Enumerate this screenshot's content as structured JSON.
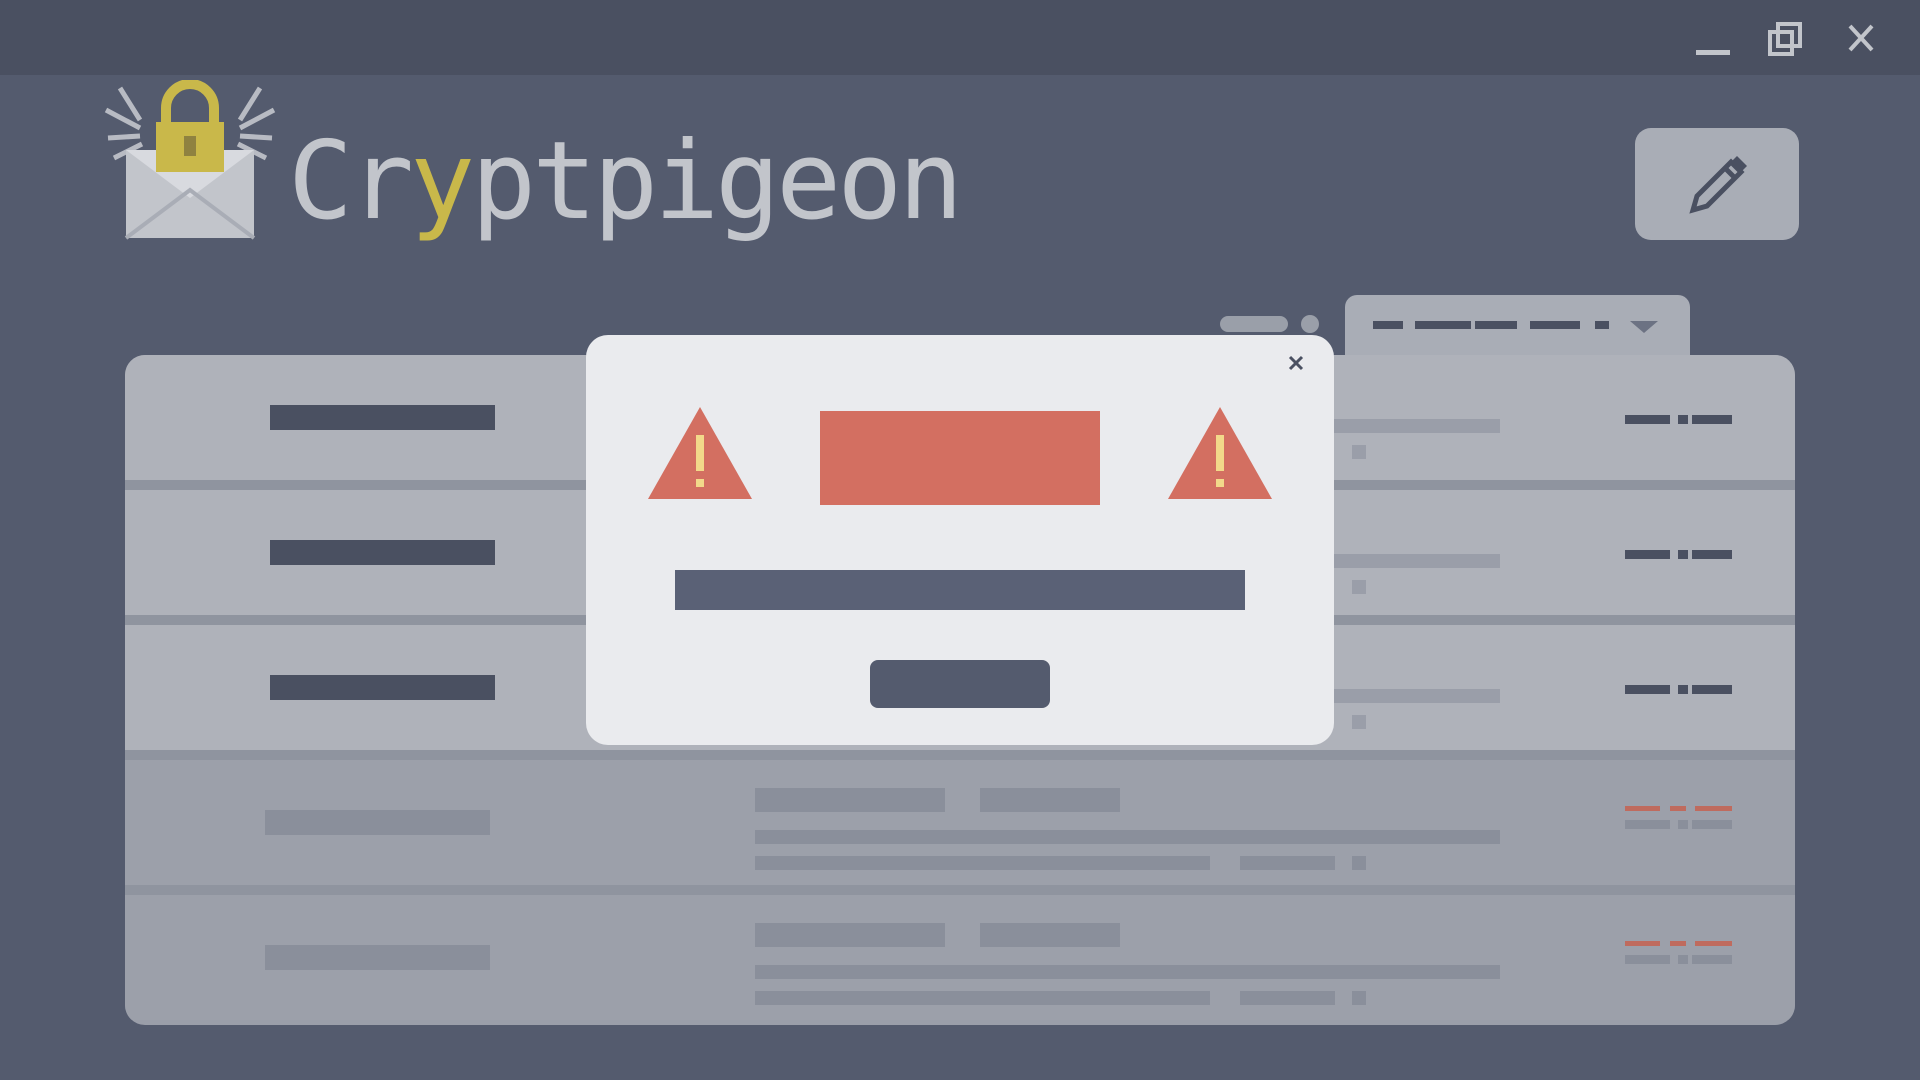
{
  "app": {
    "name_parts": [
      "Cr",
      "y",
      "ptpigeon"
    ],
    "icons": {
      "logo": "padlock-envelope-wings-icon",
      "compose": "pencil-icon",
      "minimize": "minimize-icon",
      "maximize": "maximize-icon",
      "close": "close-icon"
    },
    "colors": {
      "accent": "#c9b84a",
      "background": "#545b6e",
      "titlebar": "#4a5061",
      "warning": "#d36f61",
      "surface": "#afb2ba"
    }
  },
  "modal": {
    "title": "",
    "message": "",
    "ok_label": "",
    "icons": [
      "warning-triangle-icon",
      "close-icon"
    ]
  },
  "messages": [
    {
      "state": "unread"
    },
    {
      "state": "unread"
    },
    {
      "state": "unread"
    },
    {
      "state": "read"
    },
    {
      "state": "read"
    }
  ]
}
